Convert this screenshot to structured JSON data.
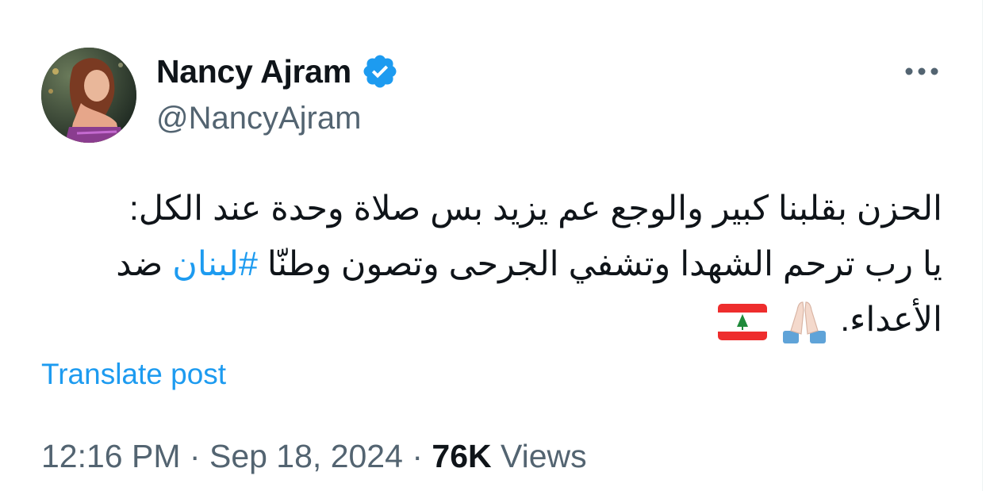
{
  "author": {
    "display_name": "Nancy Ajram",
    "handle": "@NancyAjram",
    "verified": true,
    "avatar_icon": "profile-photo"
  },
  "menu": {
    "more_icon": "more-horizontal-icon"
  },
  "tweet": {
    "line1": "الحزن بقلبنا كبير والوجع عم يزيد بس صلاة وحدة عند الكل:",
    "line2_before_hashtag": "يا رب ترحم الشهدا وتشفي الجرحى وتصون وطنّا",
    "hashtag": "#لبنان",
    "line2_after_hashtag": "ضد",
    "line3": "الأعداء.",
    "emojis": [
      "folded-hands-emoji",
      "lebanon-flag-emoji"
    ]
  },
  "translate_label": "Translate post",
  "meta": {
    "time": "12:16 PM",
    "separator": "·",
    "date": "Sep 18, 2024",
    "views_count": "76K",
    "views_label": "Views"
  },
  "colors": {
    "link": "#1d9bf0",
    "secondary_text": "#536471",
    "primary_text": "#0f1419",
    "verified_badge": "#1d9bf0"
  }
}
